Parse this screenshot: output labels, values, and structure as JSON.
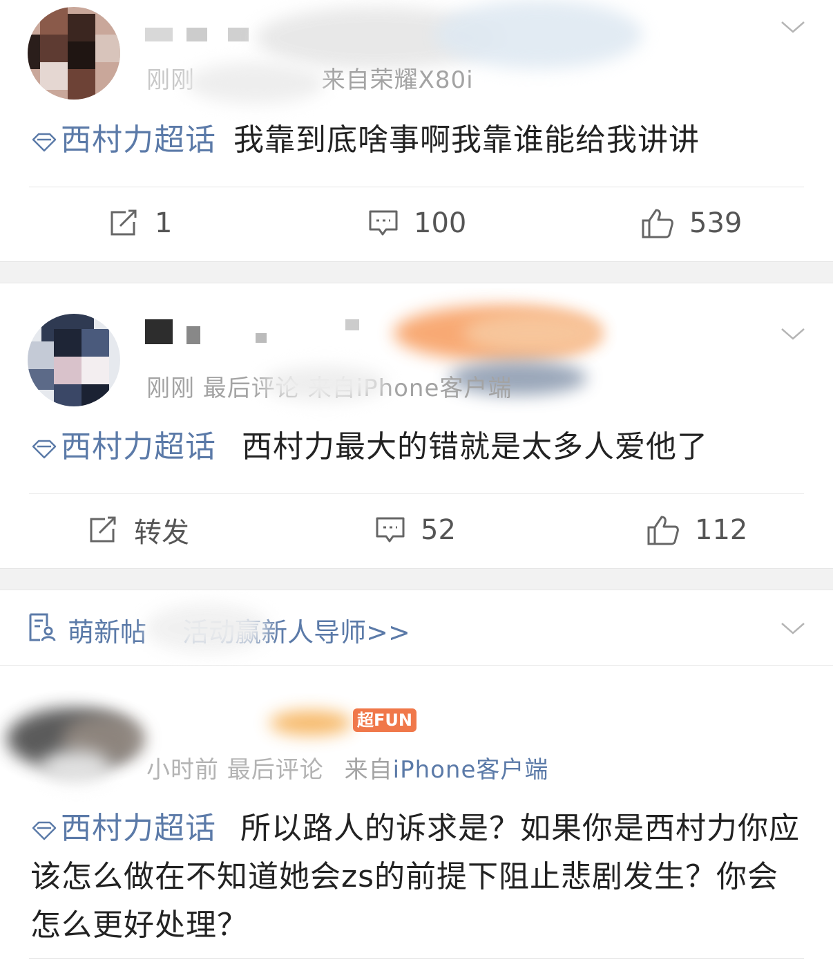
{
  "posts": [
    {
      "time_text": "刚刚",
      "source_prefix": "来自",
      "source_device": "荣耀X80i",
      "topic": "西村力超话",
      "text": "我靠到底啥事啊我靠谁能给我讲讲",
      "repost": "1",
      "comments": "100",
      "likes": "539"
    },
    {
      "time_text": "刚刚 最后评论 来自iPhone客户端",
      "topic": "西村力超话",
      "text": "西村力最大的错就是太多人爱他了",
      "repost": "转发",
      "comments": "52",
      "likes": "112"
    },
    {
      "badge": "超FUN",
      "time_text": "小时前 最后评论",
      "source_prefix": "来自",
      "source_device": "iPhone客户端",
      "topic": "西村力超话",
      "text": "所以路人的诉求是？如果你是西村力你应该怎么做在不知道她会zs的前提下阻止悲剧发生？你会怎么更好处理？"
    }
  ],
  "notice": {
    "label": "萌新帖",
    "text": "活动赢新人导师>>"
  },
  "colors": {
    "topic": "#5b7aa8",
    "gap": "#f2f2f2",
    "badge": "#f0784a"
  }
}
